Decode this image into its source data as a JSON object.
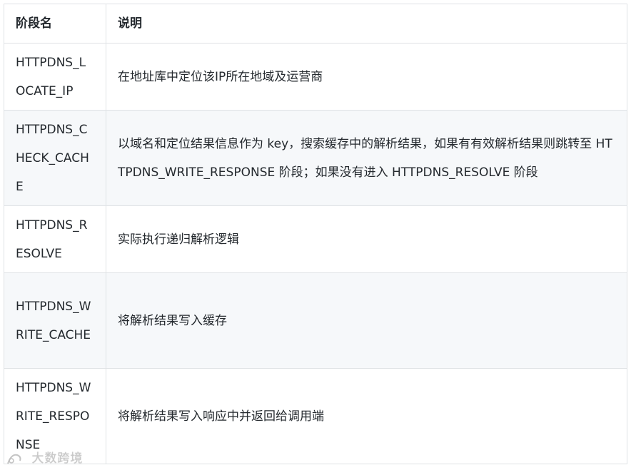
{
  "table": {
    "headers": [
      "阶段名",
      "说明"
    ],
    "rows": [
      {
        "stage": "HTTPDNS_LOCATE_IP",
        "desc": "在地址库中定位该IP所在地域及运营商"
      },
      {
        "stage": "HTTPDNS_CHECK_CACHE",
        "desc": "以域名和定位结果信息作为 key，搜索缓存中的解析结果，如果有有效解析结果则跳转至 HTTPDNS_WRITE_RESPONSE 阶段；如果没有进入 HTTPDNS_RESOLVE 阶段"
      },
      {
        "stage": "HTTPDNS_RESOLVE",
        "desc": "实际执行递归解析逻辑"
      },
      {
        "stage": "HTTPDNS_WRITE_CACHE",
        "desc": "将解析结果写入缓存"
      },
      {
        "stage": "HTTPDNS_WRITE_RESPONSE",
        "desc": "将解析结果写入响应中并返回给调用端"
      }
    ]
  },
  "watermark": {
    "text": "大数跨境"
  },
  "colors": {
    "border": "#dfe2e5",
    "stripe": "#f6f8fa",
    "text": "#24292e"
  }
}
